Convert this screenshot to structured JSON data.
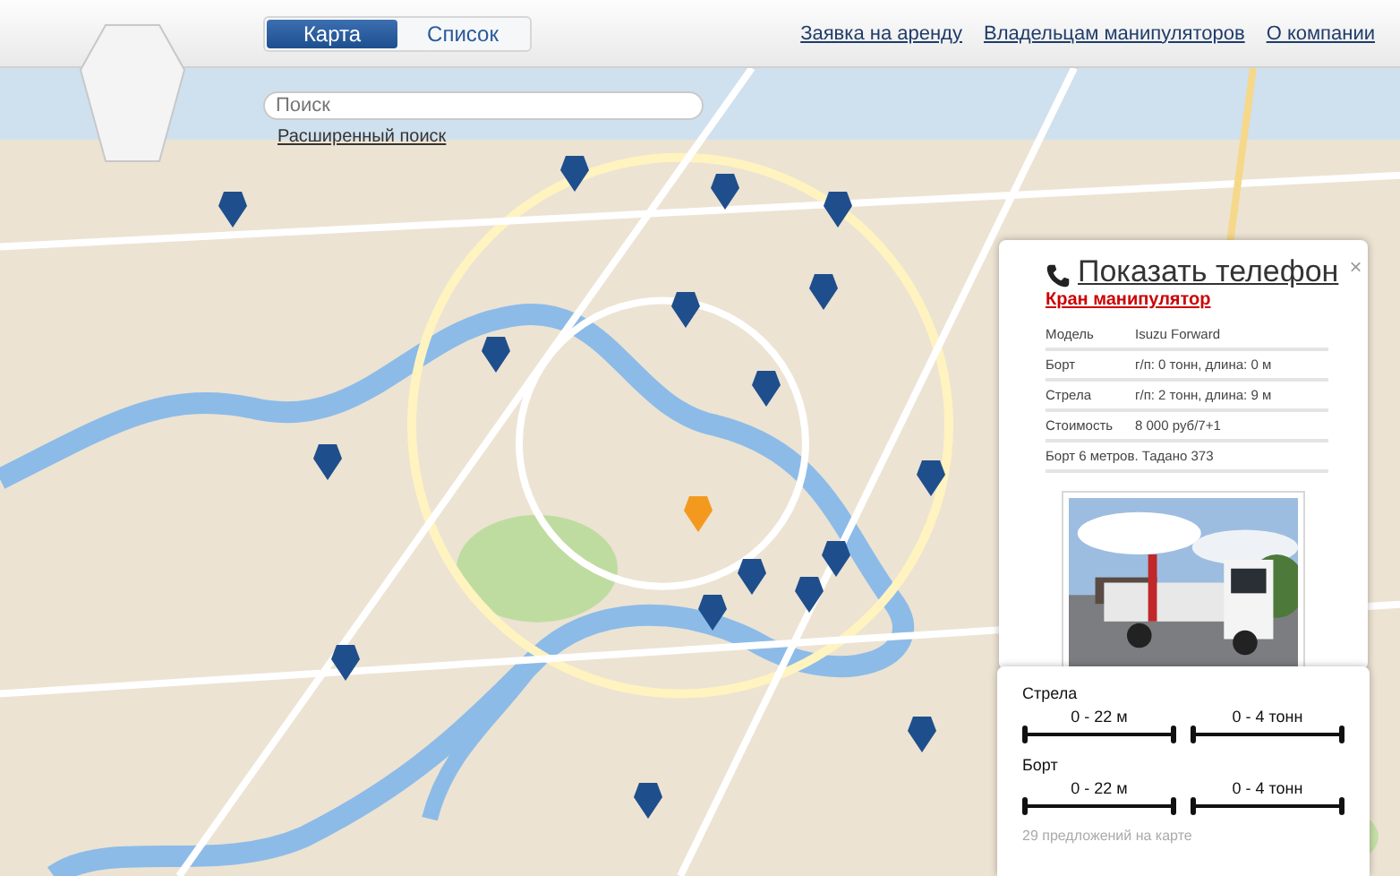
{
  "view_toggle": [
    {
      "label": "Карта",
      "selected": true
    },
    {
      "label": "Список",
      "selected": false
    }
  ],
  "nav_links": [
    "Заявка на аренду",
    "Владельцам манипуляторов",
    "О компании"
  ],
  "search": {
    "placeholder": "Поиск",
    "advanced_link": "Расширенный поиск"
  },
  "map": {
    "kind": "picture",
    "markers": [
      {
        "selected": false
      },
      {
        "selected": false
      },
      {
        "selected": false
      },
      {
        "selected": false
      },
      {
        "selected": false
      },
      {
        "selected": false
      },
      {
        "selected": false
      },
      {
        "selected": false
      },
      {
        "selected": false
      },
      {
        "selected": false
      },
      {
        "selected": true
      },
      {
        "selected": false
      },
      {
        "selected": false
      },
      {
        "selected": false
      },
      {
        "selected": false
      },
      {
        "selected": false
      },
      {
        "selected": false
      },
      {
        "selected": false
      }
    ]
  },
  "offer_card": {
    "phone_link": "Показать телефон",
    "close": "×",
    "title": "Кран манипулятор",
    "specs": [
      {
        "label": "Модель",
        "value": "Isuzu Forward"
      },
      {
        "label": "Борт",
        "value": "г/п: 0 тонн, длина: 0 м"
      },
      {
        "label": "Стрела",
        "value": "г/п: 2 тонн, длина: 9 м"
      },
      {
        "label": "Стоимость",
        "value": "8 000 руб/7+1"
      }
    ],
    "note": "Борт 6 метров. Тадано 373"
  },
  "filters": [
    {
      "label": "Стрела",
      "ranges": [
        {
          "text": "0 - 22 м",
          "level": 1
        },
        {
          "text": "0 - 4 тонн",
          "level": 1
        }
      ]
    },
    {
      "label": "Борт",
      "ranges": [
        {
          "text": "0 - 22 м",
          "level": 1
        },
        {
          "text": "0 - 4 тонн",
          "level": 1
        }
      ]
    }
  ],
  "offers_count": "29 предложений на карте"
}
